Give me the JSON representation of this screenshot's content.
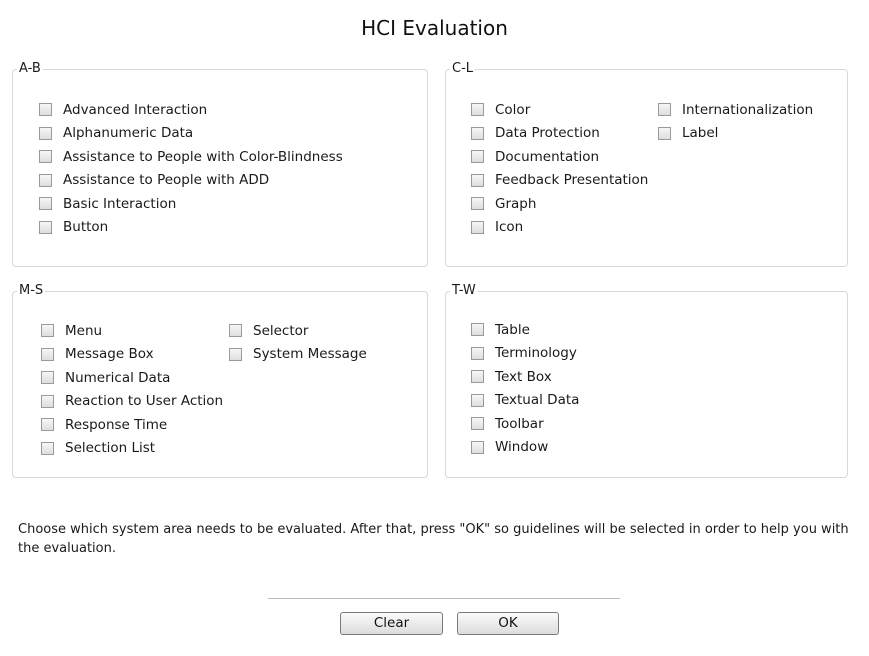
{
  "title": "HCI Evaluation",
  "groups": {
    "ab": {
      "legend": "A-B",
      "items": [
        "Advanced Interaction",
        "Alphanumeric Data",
        "Assistance to People with Color-Blindness",
        "Assistance to People with ADD",
        "Basic Interaction",
        "Button"
      ]
    },
    "cl": {
      "legend": "C-L",
      "items": [
        "Color",
        "Data Protection",
        "Documentation",
        "Feedback Presentation",
        "Graph",
        "Icon",
        "Internationalization",
        "Label"
      ]
    },
    "ms": {
      "legend": "M-S",
      "items": [
        "Menu",
        "Message Box",
        "Numerical Data",
        "Reaction to User Action",
        "Response Time",
        "Selection List",
        "Selector",
        "System Message"
      ]
    },
    "tw": {
      "legend": "T-W",
      "items": [
        "Table",
        "Terminology",
        "Text Box",
        "Textual Data",
        "Toolbar",
        "Window"
      ]
    }
  },
  "instructions": "Choose which system area needs to be evaluated. After that, press \"OK\" so guidelines will be selected in order to help you with the evaluation.",
  "buttons": {
    "clear": "Clear",
    "ok": "OK"
  }
}
